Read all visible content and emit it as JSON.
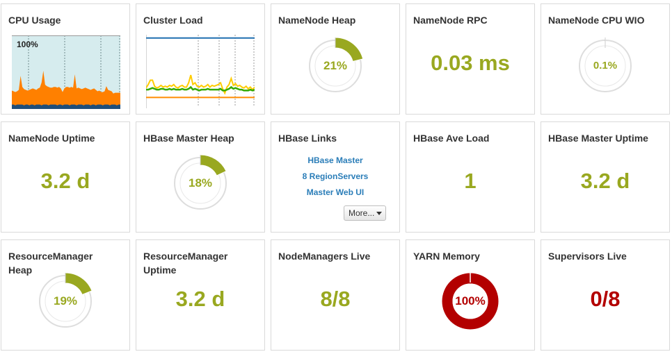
{
  "colors": {
    "green": "#99a820",
    "red": "#b30000",
    "track": "#dddddd",
    "link": "#2a7db8",
    "cpu_bg": "#d6ecee",
    "cpu_fill": "#ff8000",
    "cpu_base": "#1f4e79",
    "load_line_yellow": "#ffcc00",
    "load_line_green": "#33aa00",
    "load_line_orange": "#ff8c00",
    "load_line_blue": "#1f6fb0"
  },
  "cards": {
    "cpu_usage": {
      "title": "CPU Usage",
      "max_label": "100%"
    },
    "cluster_load": {
      "title": "Cluster Load"
    },
    "namenode_heap": {
      "title": "NameNode Heap",
      "value_label": "21%",
      "fraction": 0.21
    },
    "namenode_rpc": {
      "title": "NameNode RPC",
      "value": "0.03 ms"
    },
    "namenode_cpu_wio": {
      "title": "NameNode CPU WIO",
      "value_label": "0.1%",
      "fraction": 0.001
    },
    "namenode_uptime": {
      "title": "NameNode Uptime",
      "value": "3.2 d"
    },
    "hbase_master_heap": {
      "title": "HBase Master Heap",
      "value_label": "18%",
      "fraction": 0.18
    },
    "hbase_links": {
      "title": "HBase Links",
      "links": [
        "HBase Master",
        "8 RegionServers",
        "Master Web UI"
      ],
      "more_label": "More..."
    },
    "hbase_ave_load": {
      "title": "HBase Ave Load",
      "value": "1"
    },
    "hbase_master_uptime": {
      "title": "HBase Master Uptime",
      "value": "3.2 d"
    },
    "resourcemanager_heap": {
      "title_line1": "ResourceManager",
      "title_line2": "Heap",
      "value_label": "19%",
      "fraction": 0.19
    },
    "resourcemanager_uptime": {
      "title_line1": "ResourceManager",
      "title_line2": "Uptime",
      "value": "3.2 d"
    },
    "nodemanagers_live": {
      "title": "NodeManagers Live",
      "value": "8/8"
    },
    "yarn_memory": {
      "title": "YARN Memory",
      "value_label": "100%",
      "fraction": 1.0
    },
    "supervisors_live": {
      "title": "Supervisors Live",
      "value": "0/8"
    }
  },
  "chart_data": [
    {
      "type": "area",
      "title": "CPU Usage",
      "ylabel": "",
      "ylim": [
        0,
        100
      ],
      "series": [
        {
          "values": [
            25,
            24,
            23,
            24,
            26,
            45,
            30,
            27,
            26,
            25,
            26,
            27,
            28,
            27,
            26,
            28,
            29,
            36,
            52,
            33,
            31,
            30,
            29,
            29,
            30,
            30,
            29,
            30,
            28,
            23,
            28,
            30,
            30,
            29,
            30,
            29,
            47,
            28,
            29,
            28,
            27,
            28,
            29,
            28,
            27,
            26,
            27,
            28,
            26,
            24,
            25,
            23,
            23,
            24,
            31,
            26,
            25,
            24,
            21,
            22,
            22,
            22,
            22
          ]
        },
        {
          "values": [
            6,
            6,
            5,
            6,
            6,
            6,
            6,
            5,
            6,
            6,
            5,
            6,
            6,
            5,
            6,
            6,
            6,
            5,
            6,
            6,
            6,
            5,
            6,
            6,
            6,
            6,
            5,
            6,
            6,
            5,
            6,
            6,
            6,
            5,
            6,
            6,
            6,
            5,
            6,
            6,
            6,
            5,
            6,
            6,
            6,
            5,
            6,
            6,
            5,
            6,
            6,
            6,
            5,
            6,
            6,
            6,
            5,
            6,
            6,
            6,
            5,
            6,
            6
          ]
        }
      ]
    },
    {
      "type": "line",
      "title": "Cluster Load",
      "series": [
        {
          "values": [
            2.2,
            2.6,
            3.1,
            3.1,
            2.4,
            2.2,
            2.3,
            2.5,
            2.3,
            2.4,
            2.3,
            2.5,
            2.4,
            2.6,
            2.3,
            2.2,
            2.4,
            2.5,
            2.3,
            2.3,
            2.8,
            3.7,
            2.6,
            2.8,
            2.4,
            2.3,
            2.5,
            2.3,
            2.4,
            2.6,
            2.3,
            2.5,
            2.4,
            2.5,
            2.6,
            2.8,
            2.1,
            1.6,
            2.3,
            2.6,
            3.3,
            2.5,
            2.7,
            2.4,
            2.5,
            2.3,
            2.2,
            2.4,
            2.1,
            2.3,
            2.0,
            2.3
          ]
        },
        {
          "values": [
            2.0,
            2.0,
            2.1,
            2.2,
            2.1,
            2.0,
            2.0,
            2.1,
            2.1,
            2.0,
            2.0,
            2.1,
            2.0,
            2.1,
            2.0,
            2.0,
            2.0,
            2.1,
            2.0,
            2.0,
            2.1,
            2.3,
            2.0,
            2.1,
            2.0,
            1.9,
            2.0,
            2.0,
            2.0,
            2.1,
            2.0,
            2.0,
            2.0,
            2.0,
            2.0,
            2.1,
            1.9,
            1.9,
            2.0,
            2.1,
            2.3,
            2.1,
            2.2,
            2.1,
            2.0,
            2.0,
            1.9,
            1.9,
            1.9,
            2.0,
            1.9,
            2.0
          ]
        },
        {
          "values": [
            1.1,
            1.1,
            1.1,
            1.1,
            1.1,
            1.1,
            1.1,
            1.1,
            1.1,
            1.1,
            1.1,
            1.1,
            1.1,
            1.1,
            1.1,
            1.1,
            1.1,
            1.1,
            1.1,
            1.1,
            1.1,
            1.1,
            1.1,
            1.1,
            1.1,
            1.1,
            1.1,
            1.1,
            1.1,
            1.1,
            1.1,
            1.1,
            1.1,
            1.1,
            1.1,
            1.1,
            1.1,
            1.1,
            1.1,
            1.1,
            1.1,
            1.1,
            1.1,
            1.1,
            1.1,
            1.1,
            1.1,
            1.1,
            1.1,
            1.1,
            1.1,
            1.1
          ]
        },
        {
          "values": [
            8,
            8,
            8,
            8,
            8,
            8,
            8,
            8,
            8,
            8,
            8,
            8,
            8,
            8,
            8,
            8,
            8,
            8,
            8,
            8,
            8,
            8,
            8,
            8,
            8,
            8,
            8,
            8,
            8,
            8,
            8,
            8,
            8,
            8,
            8,
            8,
            8,
            8,
            8,
            8,
            8,
            8,
            8,
            8,
            8,
            8,
            8,
            8,
            8,
            8,
            8,
            8
          ]
        }
      ],
      "ylim": [
        0,
        8.3
      ]
    }
  ]
}
